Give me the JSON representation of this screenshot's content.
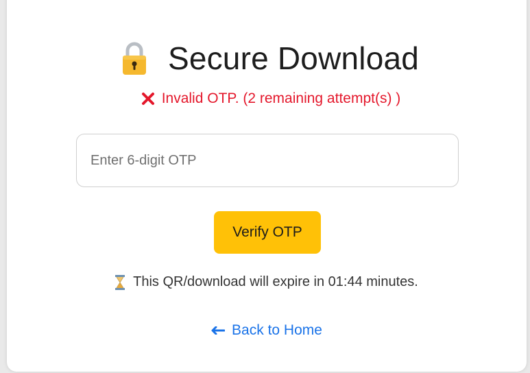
{
  "header": {
    "title": "Secure Download",
    "icon": "lock-icon"
  },
  "error": {
    "icon": "x-icon",
    "message": "Invalid OTP. (2 remaining attempt(s) )",
    "color": "#e4172b"
  },
  "form": {
    "otp_placeholder": "Enter 6-digit OTP",
    "otp_value": "",
    "verify_label": "Verify OTP",
    "verify_color": "#ffc107"
  },
  "expiry": {
    "icon": "hourglass-icon",
    "text": "This QR/download will expire in 01:44 minutes."
  },
  "nav": {
    "back_icon": "arrow-left-icon",
    "back_label": "Back to Home",
    "link_color": "#1a73e8"
  }
}
